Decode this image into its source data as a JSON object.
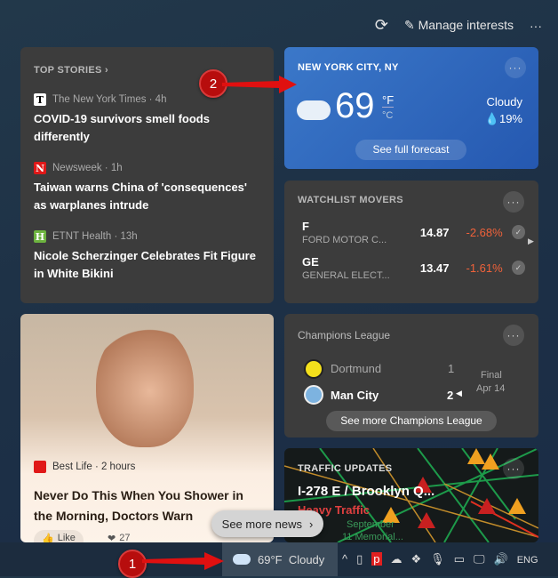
{
  "toolbar": {
    "refresh_icon": "refresh-icon",
    "manage_interests": "Manage interests",
    "more": "···"
  },
  "top_stories": {
    "header": "TOP STORIES",
    "items": [
      {
        "source": "The New York Times · 4h",
        "logo": "T",
        "logo_color": "#ffffff",
        "headline": "COVID-19 survivors smell foods differently"
      },
      {
        "source": "Newsweek · 1h",
        "logo": "N",
        "logo_color": "#e01818",
        "headline": "Taiwan warns China of 'consequences' as warplanes intrude"
      },
      {
        "source": "ETNT Health · 13h",
        "logo": "H",
        "logo_color": "#6db33f",
        "headline": "Nicole Scherzinger Celebrates Fit Figure in White Bikini"
      }
    ]
  },
  "weather": {
    "location": "NEW YORK CITY, NY",
    "temp": "69",
    "unit_f": "°F",
    "unit_c": "°C",
    "condition": "Cloudy",
    "precip": "19%",
    "forecast_button": "See full forecast",
    "accent": "#2f67c0"
  },
  "watchlist": {
    "header": "WATCHLIST MOVERS",
    "stocks": [
      {
        "symbol": "F",
        "name": "FORD MOTOR C...",
        "price": "14.87",
        "change": "-2.68%"
      },
      {
        "symbol": "GE",
        "name": "GENERAL ELECT...",
        "price": "13.47",
        "change": "-1.61%"
      }
    ],
    "negative_color": "#f0623a"
  },
  "article": {
    "source": "Best Life · 2 hours",
    "headline": "Never Do This When You Shower in the Morning, Doctors Warn",
    "reactions": "27",
    "like": "Like"
  },
  "sports": {
    "header": "Champions League",
    "teams": [
      {
        "name": "Dortmund",
        "score": "1"
      },
      {
        "name": "Man City",
        "score": "2"
      }
    ],
    "status": "Final",
    "date": "Apr 14",
    "button": "See more Champions League"
  },
  "traffic": {
    "header": "TRAFFIC UPDATES",
    "route": "I-278 E / Brooklyn Q...",
    "status": "Heavy Traffic",
    "map_labels": [
      "September",
      "11 Memorial..."
    ]
  },
  "see_more_news": "See more news",
  "taskbar": {
    "weather": "69°F  Cloudy",
    "language": "ENG"
  },
  "annotations": [
    "1",
    "2"
  ]
}
